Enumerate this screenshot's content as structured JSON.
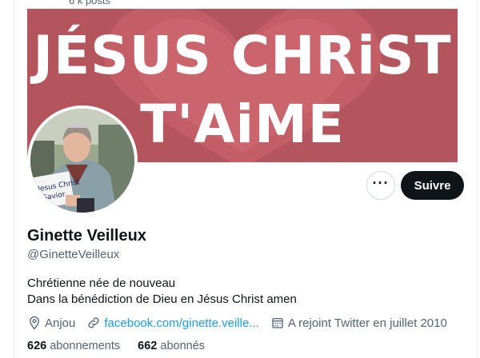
{
  "profile": {
    "top_posts_count": "6 k posts",
    "banner": {
      "line1": "JÉSUS CHRiST",
      "line2": "T'AiME"
    },
    "name": "Ginette Veilleux",
    "handle": "@GinetteVeilleux",
    "bio": [
      "Chrétienne née de nouveau",
      "Dans la bénédiction de Dieu en Jésus Christ amen"
    ],
    "location": "Anjou",
    "website": "facebook.com/ginette.veille...",
    "joined": "A rejoint Twitter en juillet 2010",
    "following_count": "626",
    "following_label": "abonnements",
    "followers_count": "662",
    "followers_label": "abonnés"
  },
  "actions": {
    "more_label": "···",
    "follow_label": "Suivre"
  },
  "icons": {
    "more": "more-icon",
    "location": "location-pin-icon",
    "link": "link-icon",
    "calendar": "calendar-icon"
  },
  "colors": {
    "accent": "#1d9bf0",
    "banner": "#b4555e",
    "follow_button": "#0f1419",
    "secondary_text": "#536471"
  }
}
